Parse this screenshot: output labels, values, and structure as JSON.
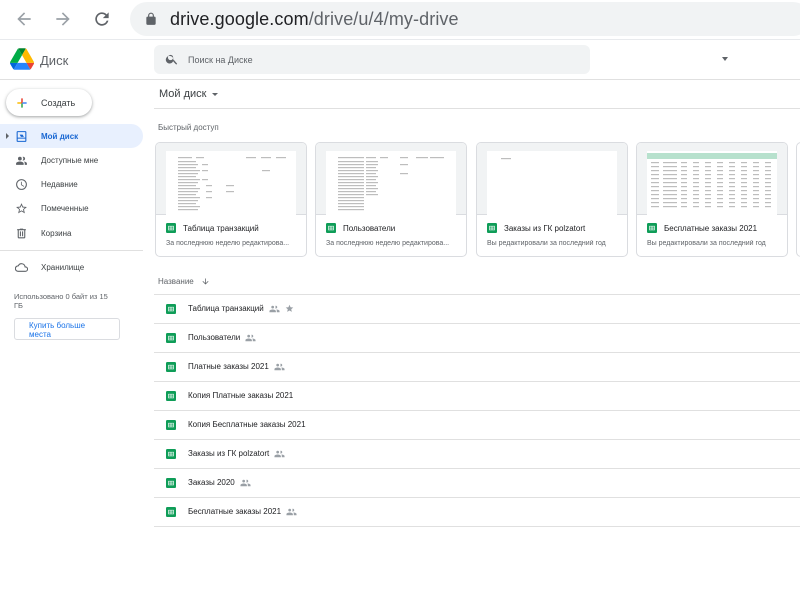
{
  "browser": {
    "url_main": "drive.google.com",
    "url_path": "/drive/u/4/my-drive"
  },
  "app": {
    "name": "Диск",
    "search_placeholder": "Поиск на Диске"
  },
  "sidebar": {
    "create_label": "Создать",
    "items": [
      {
        "label": "Мой диск",
        "icon": "my-drive-icon",
        "active": true
      },
      {
        "label": "Доступные мне",
        "icon": "shared-with-me-icon"
      },
      {
        "label": "Недавние",
        "icon": "clock-icon"
      },
      {
        "label": "Помеченные",
        "icon": "star-icon"
      },
      {
        "label": "Корзина",
        "icon": "trash-icon"
      }
    ],
    "storage_label": "Хранилище",
    "storage_used": "Использовано 0 байт из 15 ГБ",
    "buy_label": "Купить больше места"
  },
  "main": {
    "title": "Мой диск",
    "quick_access_title": "Быстрый доступ",
    "quick_access": [
      {
        "name": "Таблица транзакций",
        "sub": "За последнюю неделю редактирова..."
      },
      {
        "name": "Пользователи",
        "sub": "За последнюю неделю редактирова..."
      },
      {
        "name": "Заказы из ГК polzatort",
        "sub": "Вы редактировали за последний год"
      },
      {
        "name": "Бесплатные заказы 2021",
        "sub": "Вы редактировали за последний год"
      }
    ],
    "column_name": "Название",
    "files": [
      {
        "name": "Таблица транзакций",
        "shared": true,
        "starred": true
      },
      {
        "name": "Пользователи",
        "shared": true,
        "starred": false
      },
      {
        "name": "Платные заказы 2021",
        "shared": true,
        "starred": false
      },
      {
        "name": "Копия Платные заказы 2021",
        "shared": false,
        "starred": false
      },
      {
        "name": "Копия Бесплатные заказы 2021",
        "shared": false,
        "starred": false
      },
      {
        "name": "Заказы из ГК polzatort",
        "shared": true,
        "starred": false
      },
      {
        "name": "Заказы 2020",
        "shared": true,
        "starred": false
      },
      {
        "name": "Бесплатные заказы 2021",
        "shared": true,
        "starred": false
      }
    ]
  },
  "colors": {
    "accent": "#1967d2",
    "active_bg": "#e8f0fe",
    "sheets_green": "#0f9d58"
  }
}
